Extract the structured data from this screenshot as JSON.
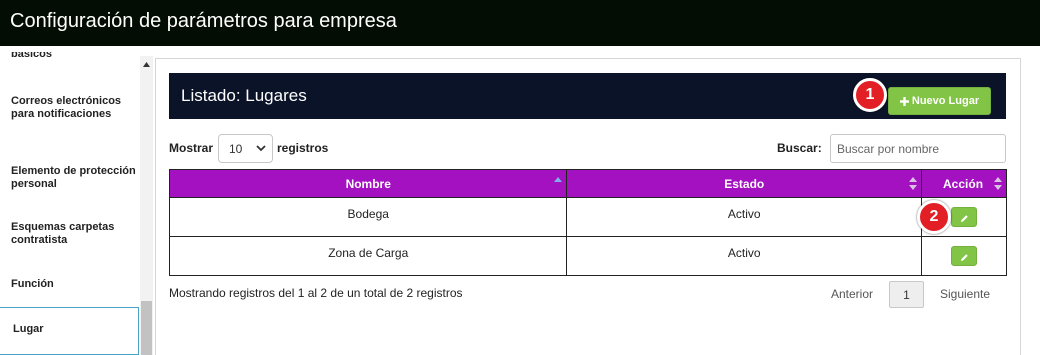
{
  "window": {
    "title": "Configuración de parámetros para empresa"
  },
  "sidebar": {
    "items": [
      {
        "label": "básicos"
      },
      {
        "label": "Correos electrónicos para notificaciones"
      },
      {
        "label": "Elemento de protección personal"
      },
      {
        "label": "Esquemas carpetas contratista"
      },
      {
        "label": "Función"
      },
      {
        "label": "Lugar",
        "active": true
      }
    ]
  },
  "panel": {
    "title": "Listado: Lugares",
    "new_button": "Nuevo Lugar",
    "new_icon": "plus-icon"
  },
  "markers": [
    "1",
    "2"
  ],
  "length_menu": {
    "prefix": "Mostrar",
    "value": "10",
    "suffix": "registros"
  },
  "search": {
    "label": "Buscar:",
    "placeholder": "Buscar por nombre",
    "value": ""
  },
  "table": {
    "headers": [
      "Nombre",
      "Estado",
      "Acción"
    ],
    "rows": [
      {
        "nombre": "Bodega",
        "estado": "Activo"
      },
      {
        "nombre": "Zona de Carga",
        "estado": "Activo"
      }
    ]
  },
  "footer": {
    "info": "Mostrando registros del 1 al 2 de un total de 2 registros",
    "prev": "Anterior",
    "page": "1",
    "next": "Siguiente"
  },
  "colors": {
    "titlebar": "#040d04",
    "header_bar": "#0b1329",
    "table_header": "#a311c1",
    "button_green": "#82c446",
    "marker_red": "#e31f26"
  }
}
